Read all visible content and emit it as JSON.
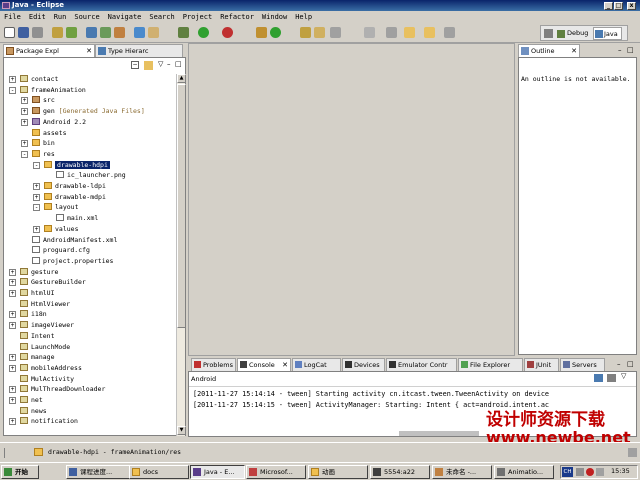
{
  "window": {
    "title": "Java - Eclipse"
  },
  "menu": [
    "File",
    "Edit",
    "Run",
    "Source",
    "Navigate",
    "Search",
    "Project",
    "Refactor",
    "Window",
    "Help"
  ],
  "perspectives": {
    "debug": "Debug",
    "java": "Java"
  },
  "left_tabs": {
    "package_explorer": "Package Expl",
    "type_hierarchy": "Type Hierarc"
  },
  "tree": [
    {
      "label": "contact",
      "icon": "project",
      "indent": 0,
      "expander": "+"
    },
    {
      "label": "frameAnimation",
      "icon": "project",
      "indent": 0,
      "expander": "-"
    },
    {
      "label": "src",
      "icon": "package-folder",
      "indent": 1,
      "expander": "+"
    },
    {
      "label": "gen",
      "suffix": " [Generated Java Files]",
      "icon": "package-folder",
      "indent": 1,
      "expander": "+"
    },
    {
      "label": "Android 2.2",
      "icon": "library",
      "indent": 1,
      "expander": "+"
    },
    {
      "label": "assets",
      "icon": "folder",
      "indent": 1,
      "expander": ""
    },
    {
      "label": "bin",
      "icon": "folder",
      "indent": 1,
      "expander": "+"
    },
    {
      "label": "res",
      "icon": "folder",
      "indent": 1,
      "expander": "-"
    },
    {
      "label": "drawable-hdpi",
      "icon": "folder",
      "indent": 2,
      "expander": "-",
      "selected": true
    },
    {
      "label": "ic_launcher.png",
      "icon": "file",
      "indent": 3,
      "expander": ""
    },
    {
      "label": "drawable-ldpi",
      "icon": "folder",
      "indent": 2,
      "expander": "+"
    },
    {
      "label": "drawable-mdpi",
      "icon": "folder",
      "indent": 2,
      "expander": "+"
    },
    {
      "label": "layout",
      "icon": "folder",
      "indent": 2,
      "expander": "-"
    },
    {
      "label": "main.xml",
      "icon": "file",
      "indent": 3,
      "expander": ""
    },
    {
      "label": "values",
      "icon": "folder",
      "indent": 2,
      "expander": "+"
    },
    {
      "label": "AndroidManifest.xml",
      "icon": "file",
      "indent": 1,
      "expander": ""
    },
    {
      "label": "proguard.cfg",
      "icon": "file",
      "indent": 1,
      "expander": ""
    },
    {
      "label": "project.properties",
      "icon": "file",
      "indent": 1,
      "expander": ""
    },
    {
      "label": "gesture",
      "icon": "project",
      "indent": 0,
      "expander": "+"
    },
    {
      "label": "GestureBuilder",
      "icon": "project",
      "indent": 0,
      "expander": "+"
    },
    {
      "label": "htmlUI",
      "icon": "project",
      "indent": 0,
      "expander": "+"
    },
    {
      "label": "HtmlViewer",
      "icon": "project",
      "indent": 0,
      "expander": ""
    },
    {
      "label": "i18n",
      "icon": "project",
      "indent": 0,
      "expander": "+"
    },
    {
      "label": "imageViewer",
      "icon": "project",
      "indent": 0,
      "expander": "+"
    },
    {
      "label": "Intent",
      "icon": "project",
      "indent": 0,
      "expander": ""
    },
    {
      "label": "LaunchMode",
      "icon": "project",
      "indent": 0,
      "expander": ""
    },
    {
      "label": "manage",
      "icon": "project",
      "indent": 0,
      "expander": "+"
    },
    {
      "label": "mobileAddress",
      "icon": "project",
      "indent": 0,
      "expander": "+"
    },
    {
      "label": "MulActivity",
      "icon": "project",
      "indent": 0,
      "expander": ""
    },
    {
      "label": "MulThreadDownloader",
      "icon": "project",
      "indent": 0,
      "expander": "+"
    },
    {
      "label": "net",
      "icon": "project",
      "indent": 0,
      "expander": "+"
    },
    {
      "label": "news",
      "icon": "project",
      "indent": 0,
      "expander": ""
    },
    {
      "label": "notification",
      "icon": "project",
      "indent": 0,
      "expander": "+"
    }
  ],
  "outline": {
    "tab": "Outline",
    "message": "An outline is not available."
  },
  "bottom_tabs": [
    "Problems",
    "Console",
    "LogCat",
    "Devices",
    "Emulator Contr",
    "File Explorer",
    "JUnit",
    "Servers"
  ],
  "console": {
    "label": "Android",
    "lines": [
      "[2011-11-27 15:14:14 - tween] Starting activity cn.itcast.tween.TweenActivity on device",
      "[2011-11-27 15:14:15 - tween] ActivityManager: Starting: Intent { act=android.intent.ac"
    ]
  },
  "status": {
    "selection": "drawable-hdpi - frameAnimation/res"
  },
  "taskbar": {
    "start": "开始",
    "tasks": [
      "课程进度...",
      "docs",
      "Java - E...",
      "Microsof...",
      "动画",
      "5554:a22",
      "未命名 -...",
      "Animatio..."
    ],
    "clock": "15:35",
    "ime": "CH"
  },
  "watermark": {
    "line1": "设计师资源下载",
    "line2": "www.newbe.net"
  }
}
